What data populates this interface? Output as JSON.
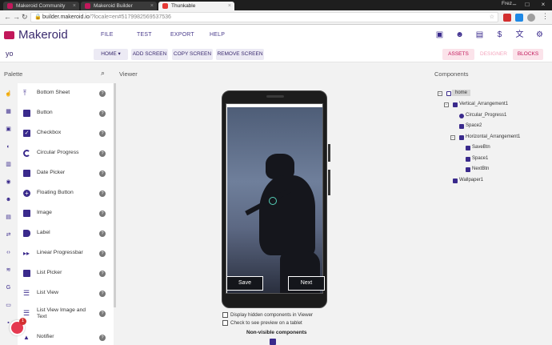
{
  "browser": {
    "tabs": [
      {
        "title": "Makeroid Community"
      },
      {
        "title": "Makeroid Builder"
      },
      {
        "title": "Thunkable"
      }
    ],
    "user": "Frez",
    "url_host": "builder.makeroid.io",
    "url_path": "/?locale=en#5179982569537536"
  },
  "app": {
    "brand": "Makeroid",
    "menu": [
      "FILE",
      "TEST",
      "EXPORT",
      "HELP"
    ],
    "project_name": "yo",
    "screen_select": "HOME ▾",
    "screen_buttons": [
      "ADD SCREEN",
      "COPY SCREEN",
      "REMOVE SCREEN"
    ],
    "view_buttons": [
      "ASSETS",
      "DESIGNER",
      "BLOCKS"
    ]
  },
  "palette": {
    "title": "Palette",
    "items": [
      {
        "label": "Bottom Sheet"
      },
      {
        "label": "Button"
      },
      {
        "label": "Checkbox"
      },
      {
        "label": "Circular Progress"
      },
      {
        "label": "Date Picker"
      },
      {
        "label": "Floating Button"
      },
      {
        "label": "Image"
      },
      {
        "label": "Label"
      },
      {
        "label": "Linear Progressbar"
      },
      {
        "label": "List Picker"
      },
      {
        "label": "List View"
      },
      {
        "label": "List View Image and Text"
      },
      {
        "label": "Notifier"
      }
    ],
    "help_glyph": "?"
  },
  "viewer": {
    "title": "Viewer",
    "save_label": "Save",
    "next_label": "Next",
    "display_hidden": "Display hidden components in Viewer",
    "tablet_preview": "Check to see preview on a tablet",
    "nonvisible": "Non-visible components"
  },
  "components": {
    "title": "Components",
    "tree": [
      {
        "label": "home"
      },
      {
        "label": "Vertical_Arrangement1"
      },
      {
        "label": "Circular_Progress1"
      },
      {
        "label": "Space2"
      },
      {
        "label": "Horizontal_Arrangement1"
      },
      {
        "label": "SaveBtn"
      },
      {
        "label": "Space1"
      },
      {
        "label": "NextBtn"
      },
      {
        "label": "Wallpaper1"
      }
    ]
  },
  "colors": {
    "brand": "#c2185b",
    "primary": "#3a2a8c"
  },
  "notification_count": "1"
}
